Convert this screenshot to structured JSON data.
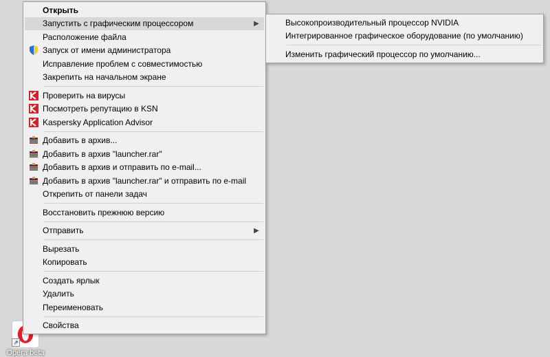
{
  "desktop": {
    "icon_label": "Opera beta"
  },
  "main_menu": {
    "items": [
      {
        "label": "Открыть",
        "bold": true
      },
      {
        "label": "Запустить с графическим процессором",
        "arrow": true,
        "highlighted": true
      },
      {
        "label": "Расположение файла"
      },
      {
        "label": "Запуск от имени администратора",
        "icon": "shield"
      },
      {
        "label": "Исправление проблем с совместимостью"
      },
      {
        "label": "Закрепить на начальном экране"
      },
      {
        "sep": true
      },
      {
        "label": "Проверить на вирусы",
        "icon": "kaspersky"
      },
      {
        "label": "Посмотреть репутацию в KSN",
        "icon": "kaspersky"
      },
      {
        "label": "Kaspersky Application Advisor",
        "icon": "kaspersky"
      },
      {
        "sep": true
      },
      {
        "label": "Добавить в архив...",
        "icon": "winrar"
      },
      {
        "label": "Добавить в архив \"launcher.rar\"",
        "icon": "winrar"
      },
      {
        "label": "Добавить в архив и отправить по e-mail...",
        "icon": "winrar"
      },
      {
        "label": "Добавить в архив \"launcher.rar\" и отправить по e-mail",
        "icon": "winrar"
      },
      {
        "label": "Открепить от панели задач"
      },
      {
        "sep": true
      },
      {
        "label": "Восстановить прежнюю версию"
      },
      {
        "sep": true
      },
      {
        "label": "Отправить",
        "arrow": true
      },
      {
        "sep": true
      },
      {
        "label": "Вырезать"
      },
      {
        "label": "Копировать"
      },
      {
        "sep": true
      },
      {
        "label": "Создать ярлык"
      },
      {
        "label": "Удалить"
      },
      {
        "label": "Переименовать"
      },
      {
        "sep": true
      },
      {
        "label": "Свойства"
      }
    ]
  },
  "sub_menu": {
    "items": [
      {
        "label": "Высокопроизводительный процессор NVIDIA"
      },
      {
        "label": "Интегрированное графическое оборудование (по умолчанию)"
      },
      {
        "sep": true
      },
      {
        "label": "Изменить графический процессор по умолчанию..."
      }
    ]
  }
}
